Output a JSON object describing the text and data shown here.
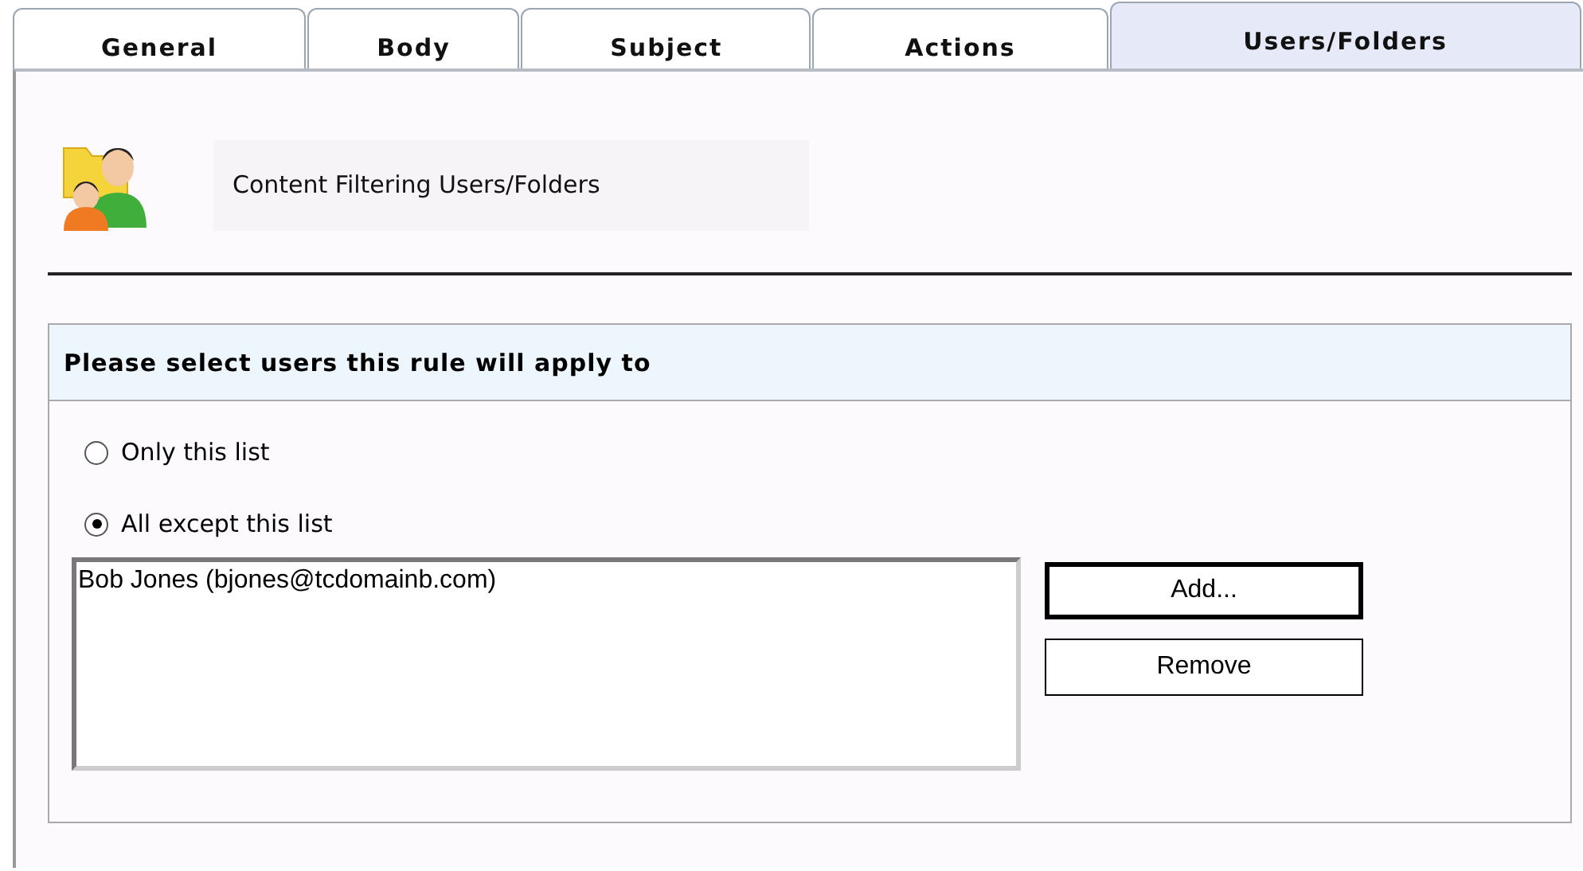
{
  "tabs": [
    {
      "label": "General",
      "selected": false
    },
    {
      "label": "Body",
      "selected": false
    },
    {
      "label": "Subject",
      "selected": false
    },
    {
      "label": "Actions",
      "selected": false
    },
    {
      "label": "Users/Folders",
      "selected": true
    }
  ],
  "header": {
    "title": "Content Filtering Users/Folders"
  },
  "group": {
    "title": "Please select users this rule will apply to",
    "options": [
      {
        "label": "Only this list",
        "selected": false
      },
      {
        "label": "All except this list",
        "selected": true
      }
    ],
    "list": {
      "items": [
        {
          "text": "Bob Jones (bjones@tcdomainb.com)",
          "selected": false
        }
      ]
    },
    "buttons": [
      {
        "label": "Add...",
        "default": true
      },
      {
        "label": "Remove",
        "default": false
      }
    ]
  }
}
